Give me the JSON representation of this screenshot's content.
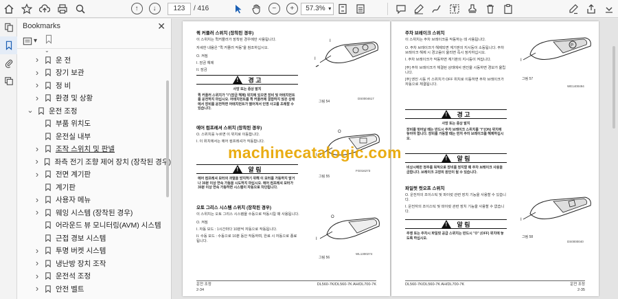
{
  "toolbar": {
    "current_page": "123",
    "total_pages": "/ 416",
    "zoom": "57.3%"
  },
  "panel": {
    "title": "Bookmarks",
    "items": [
      {
        "label": "운 전",
        "level": 1,
        "chevron": "right"
      },
      {
        "label": "장기 보관",
        "level": 1,
        "chevron": "right"
      },
      {
        "label": "정 비",
        "level": 1,
        "chevron": "right"
      },
      {
        "label": "환경 및 상황",
        "level": 1,
        "chevron": "right"
      },
      {
        "label": "운전 조정",
        "level": 0,
        "chevron": "down"
      },
      {
        "label": "부품 위치도",
        "level": 1,
        "chevron": ""
      },
      {
        "label": "운전실 내부",
        "level": 1,
        "chevron": ""
      },
      {
        "label": "조작 스위치 및 판넬",
        "level": 1,
        "chevron": "right"
      },
      {
        "label": "좌측 전기 조향 제어 장치 (장착된 경우)",
        "level": 1,
        "chevron": "right"
      },
      {
        "label": "전면 계기판",
        "level": 1,
        "chevron": "right"
      },
      {
        "label": "계기판",
        "level": 1,
        "chevron": ""
      },
      {
        "label": "사용자 메뉴",
        "level": 1,
        "chevron": "right"
      },
      {
        "label": "웨잉 시스템 (장착된 경우)",
        "level": 1,
        "chevron": "right"
      },
      {
        "label": "어라운드 뷰 모니터링(AVM) 시스템",
        "level": 1,
        "chevron": ""
      },
      {
        "label": "근접 경보 시스템",
        "level": 1,
        "chevron": ""
      },
      {
        "label": "투명 버켓 시스템",
        "level": 1,
        "chevron": "right"
      },
      {
        "label": "냉난방 장치 조작",
        "level": 1,
        "chevron": "right"
      },
      {
        "label": "운전석 조정",
        "level": 1,
        "chevron": "right"
      },
      {
        "label": "안전 벨트",
        "level": 1,
        "chevron": "right"
      }
    ]
  },
  "left_page": {
    "s1_title": "퀵 커플러 스위치 (장착된 경우)",
    "s1_body": "이 스위치는 퀵커플러가 장착된 경우에만 사용됩니다.",
    "s1_note": "자세한 내용은 \"퀵 커플러 작동\"을 참조하십시오.",
    "s1_o": "O. 켜짐",
    "s1_i": "I. 잠금 해제",
    "s1_ii": "II. 잠금",
    "warn1_label": "경 고",
    "warn1_sub": "사망 또는 중상 발지",
    "warn1_text": "퀵 커플러 스위치가 \"I\"(잠금 해제) 위치에 있으면 장비 및 어태치먼트를 운전하지 마십시오. 어태치먼트를 퀵 커플러에 결합하지 않은 상태에서 장비를 운전하면 어태치먼트가 떨어져서 인명 사고를 초래할 수 있습니다.",
    "fig1_cap": "그림 54",
    "fig1_code": "DS0004617",
    "s2_title": "에어 컴프레셔 스위치 (장착된 경우)",
    "s2_o": "O. 스위치를 누르면 이 위치로 이동합니다.",
    "s2_i": "I. 이 위치에서는 에어 컴프레셔가 작동합니다.",
    "fig2_cap": "그림 55",
    "fig2_code": "FG016273",
    "warn2_label": "알 림",
    "warn2_text": "에어 컴프레셔 모터의 과열을 방지하기 위해 이 모터를 가동하지 말거나 30분 이상 연속 가동을 시도하지 마십시오. 에어 컴프레셔 모터가 30분 이상 연속 가동하면 시스템이 자동으로 차단됩니다.",
    "s3_title": "오토 그리스 시스템 스위치 (장착된 경우)",
    "s3_body": "이 스위치는 오토 그리스 시스템을 수동으로 작동시킬 때 사용됩니다.",
    "s3_o": "O. 켜짐",
    "s3_i": "I. 자동 모드 : 1시간마다 10분씩 자동으로 작동됩니다.",
    "s3_ii": "II. 수동 모드 : 수동으로 10분 동안 작동하며, 완료 시 자동으로 종료됩니다.",
    "fig3_cap": "그림 56",
    "fig3_code": "WL1300274",
    "footer_section": "운전 조정",
    "footer_page": "2-34",
    "footer_model": "DL560-7K/DL560-7K AH/DL700-7K"
  },
  "right_page": {
    "s1_title": "주차 브레이크 스위치",
    "s1_body": "이 스위치는 주차 브레이크를 작동하는 데 사용됩니다.",
    "s1_o": "O. 주차 브레이크가 해제되면 계기판의 지시등이 소등됩니다. 주차 브레이크 해제 시 경고음이 울리면 즉시 정지하십시오.",
    "s1_i": "I. 주차 브레이크가 작동하면 계기판의 지시등이 켜집니다.",
    "note1": "[주] 주차 브레이크가 체결된 상태에서 엔진을 시동하면 경보가 울립니다.",
    "note2": "[주] 엔진 시동 키 스위치가 OFF 위치로 이동하면 주차 브레이크가 자동으로 체결됩니다.",
    "fig1_cap": "그림 57",
    "fig1_code": "WE1400494",
    "warn1_label": "경 고",
    "warn1_sub": "사망 또는 중상 발지",
    "warn1_text": "장비를 벗어날 때는 반드시 주차 브레이크 스위치를 \"I\"(ON) 위치에 놓아야 합니다. 장비를 가동할 때는 먼저 주차 브레이크를 해제하십시오.",
    "warn2_label": "알 림",
    "warn2_text": "비상시에만 정주를 목적으로 장비를 정지할 때 주차 브레이크 사용을 금합니다. 브레이크 고장의 원인이 될 수 있습니다.",
    "s2_title": "파일럿 컷오프 스위치",
    "s2_o": "O. 운전자의 조이스틱 및 파이럿 관련 장치 기능을 사용할 수 있습니다.",
    "s2_i": "I. 운전자의 조이스틱 및 파이럿 관련 장치 기능을 사용할 수 없습니다.",
    "fig2_cap": "그림 58",
    "fig2_code": "DS0000040",
    "warn3_label": "알 림",
    "warn3_text": "주행 또는 주차시 파일럿 공급 스위치는 반드시 \"O\" (OFF) 위치에 놓도록 하십시오.",
    "footer_section": "운전 조정",
    "footer_page": "2-35",
    "footer_model": "DL560-7K/DL560-7K AH/DL700-7K"
  },
  "watermark": "machinecatalogic.com"
}
